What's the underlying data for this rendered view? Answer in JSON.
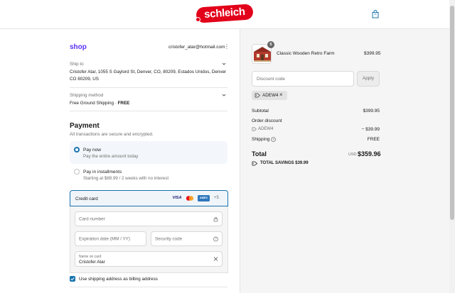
{
  "header": {
    "logo_text": "schleich"
  },
  "account": {
    "shop_label": "shop",
    "email": "cristofer_atar@hotmail.com"
  },
  "ship_to": {
    "label": "Ship to",
    "value": "Cristofer Atar, 1055 S Gaylord St, Denver, CO, 80209, Estados Unidos, Denver CO 80209, US"
  },
  "shipping_method": {
    "label": "Shipping method",
    "value": "Free Ground Shipping",
    "sep": " · ",
    "price": "FREE"
  },
  "payment": {
    "title": "Payment",
    "subtitle": "All transactions are secure and encrypted.",
    "options": [
      {
        "title": "Pay now",
        "sub": "Pay the entire amount today",
        "selected": true
      },
      {
        "title": "Pay in installments",
        "sub": "Starting at $89.99 / 2 weeks with no interest",
        "selected": false
      }
    ],
    "credit_card": {
      "label": "Credit card",
      "brands": [
        "VISA",
        "Mastercard",
        "AMEX"
      ],
      "more": "+5",
      "card_number_placeholder": "Card number",
      "expiration_placeholder": "Expiration date (MM / YY)",
      "security_placeholder": "Security code",
      "name_label": "Name on card",
      "name_value": "Cristofer Atar"
    },
    "billing_checkbox": "Use shipping address as billing address"
  },
  "summary": {
    "item": {
      "name": "Classic Wooden Retro Farm",
      "price": "$399.95",
      "qty": "5"
    },
    "discount_placeholder": "Discount code",
    "apply_label": "Apply",
    "applied_code": "ADEW4",
    "subtotal_label": "Subtotal",
    "subtotal_value": "$399.95",
    "order_discount_label": "Order discount",
    "discount_code": "ADEW4",
    "discount_value": "− $39.99",
    "shipping_label": "Shipping",
    "shipping_value": "FREE",
    "total_label": "Total",
    "currency": "USD",
    "total_value": "$359.96",
    "savings_label": "TOTAL SAVINGS",
    "savings_value": "$39.99"
  },
  "colors": {
    "brand_red": "#e2001a",
    "shop_purple": "#5a31f4",
    "accent_blue": "#1773b0"
  }
}
